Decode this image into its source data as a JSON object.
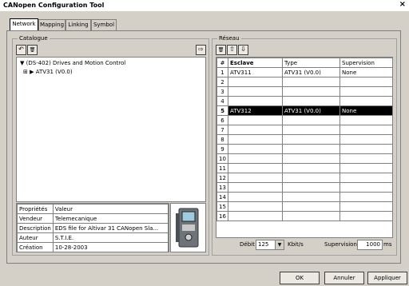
{
  "window": {
    "title": "CANopen Configuration Tool",
    "close_glyph": "×"
  },
  "tabs": [
    {
      "label": "Network",
      "active": true
    },
    {
      "label": "Mapping",
      "active": false
    },
    {
      "label": "Linking",
      "active": false
    },
    {
      "label": "Symbol",
      "active": false
    }
  ],
  "catalogue": {
    "title": "Catalogue",
    "tree_root": "(DS-402) Drives and Motion Control",
    "tree_child": "ATV31 (V0.0)",
    "properties_headers": [
      "Propriétés",
      "Valeur"
    ],
    "properties": [
      [
        "Vendeur",
        "Telemecanique"
      ],
      [
        "Description",
        "EDS file for Altivar 31 CANopen Sla..."
      ],
      [
        "Auteur",
        "S.T.I.E."
      ],
      [
        "Création",
        "10-28-2003"
      ]
    ]
  },
  "reseau": {
    "title": "Réseau",
    "columns": [
      "#",
      "Esclave",
      "Type",
      "Supervision"
    ],
    "rows": [
      [
        "1",
        "ATV311",
        "ATV31 (V0.0)",
        "None"
      ],
      [
        "2",
        "",
        "",
        ""
      ],
      [
        "3",
        "",
        "",
        ""
      ],
      [
        "4",
        "",
        "",
        ""
      ],
      [
        "5",
        "ATV312",
        "ATV31 (V0.0)",
        "None"
      ],
      [
        "6",
        "",
        "",
        ""
      ],
      [
        "7",
        "",
        "",
        ""
      ],
      [
        "8",
        "",
        "",
        ""
      ],
      [
        "9",
        "",
        "",
        ""
      ],
      [
        "10",
        "",
        "",
        ""
      ],
      [
        "11",
        "",
        "",
        ""
      ],
      [
        "12",
        "",
        "",
        ""
      ],
      [
        "13",
        "",
        "",
        ""
      ],
      [
        "14",
        "",
        "",
        ""
      ],
      [
        "15",
        "",
        "",
        ""
      ],
      [
        "16",
        "",
        "",
        ""
      ]
    ],
    "selected_row": "5",
    "debit_label": "Débit",
    "debit_value": "125",
    "debit_unit": "Kbit/s",
    "supervision_label": "Supervision",
    "supervision_value": "1000",
    "supervision_unit": "ms"
  },
  "buttons": {
    "ok": "OK",
    "cancel": "Annuler",
    "apply": "Appliquer"
  },
  "icons": {
    "tree_expand": "⊞",
    "tree_arrow_open": "▼",
    "tree_arrow_closed": "▶",
    "delete": "🗑",
    "export": "⇨",
    "up": "⇧",
    "down": "⇩",
    "dropdown": "▼"
  }
}
